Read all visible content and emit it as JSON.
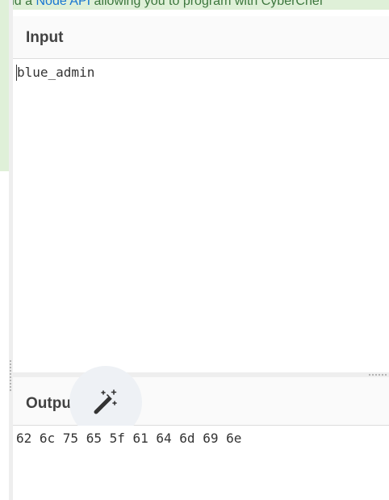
{
  "banner": {
    "pre_text": "and a ",
    "link_text": "Node API",
    "post_text": " allowing you to program with CyberChef"
  },
  "input": {
    "title": "Input",
    "value": "blue_admin"
  },
  "output": {
    "title": "Output",
    "magic_icon": "magic-wand-icon",
    "value": "62 6c 75 65 5f 61 64 6d 69 6e"
  },
  "colors": {
    "notice_bg": "#dff0d8",
    "notice_text": "#3c763d",
    "link": "#1976d2",
    "header_bg": "#fafafa",
    "magic_bg": "#eef1f5"
  }
}
